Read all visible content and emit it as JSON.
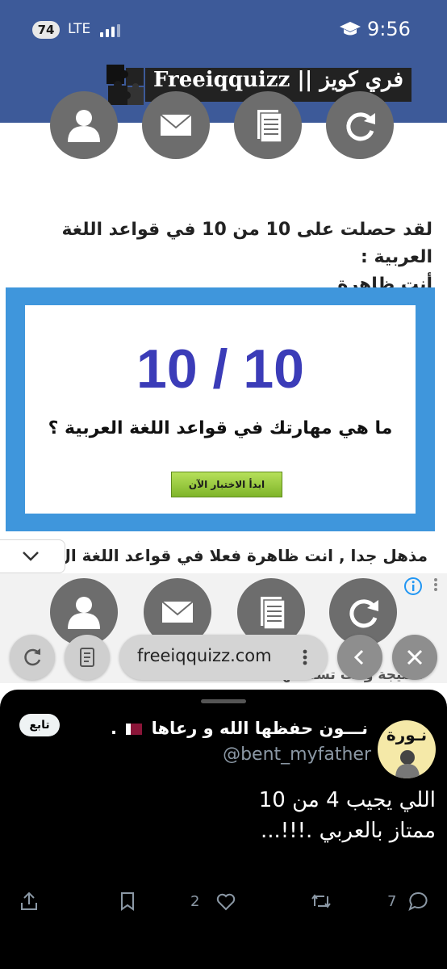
{
  "status_bar": {
    "battery": "74",
    "network": "LTE",
    "time": "9:56"
  },
  "site": {
    "logo_text": "Freeiqquizz || فري كويز"
  },
  "share_icons": [
    "person-icon",
    "mail-icon",
    "document-icon",
    "refresh-icon"
  ],
  "article": {
    "headline_line1": "لقد حصلت على 10 من 10 في قواعد اللغة العربية :",
    "headline_line2": "أنت ظاهرة",
    "quiz_card": {
      "score": "10 / 10",
      "question": "ما هي مهارتك في قواعد اللغة العربية ؟",
      "start_button": "ابدأ الاختبار الآن"
    },
    "body_partial": "مذهل جدا , انت ظاهرة فعلا في قواعد اللغة ال",
    "body_partial_2": "النتيجة وأنت تستحقها."
  },
  "browser": {
    "url": "freeiqquizz.com"
  },
  "tweet": {
    "display_name": "نـــون حفظها الله و رعاها",
    "display_name_suffix": "...",
    "handle": "@bent_myfather",
    "avatar_text": "نـورة",
    "follow_label": "تابع",
    "text": "اللي  يجيب 4 من 10\nممتاز بالعربي .!!!...",
    "likes": "2",
    "replies": "7"
  },
  "colors": {
    "header_blue": "#3d5a99",
    "quiz_frame_blue": "#3f96dc",
    "score_color": "#3b3cb8",
    "start_button_green": "#8cc63f",
    "icon_gray": "#6d6d6d",
    "tweet_bg": "#000000",
    "tweet_muted": "#8b98a5"
  }
}
